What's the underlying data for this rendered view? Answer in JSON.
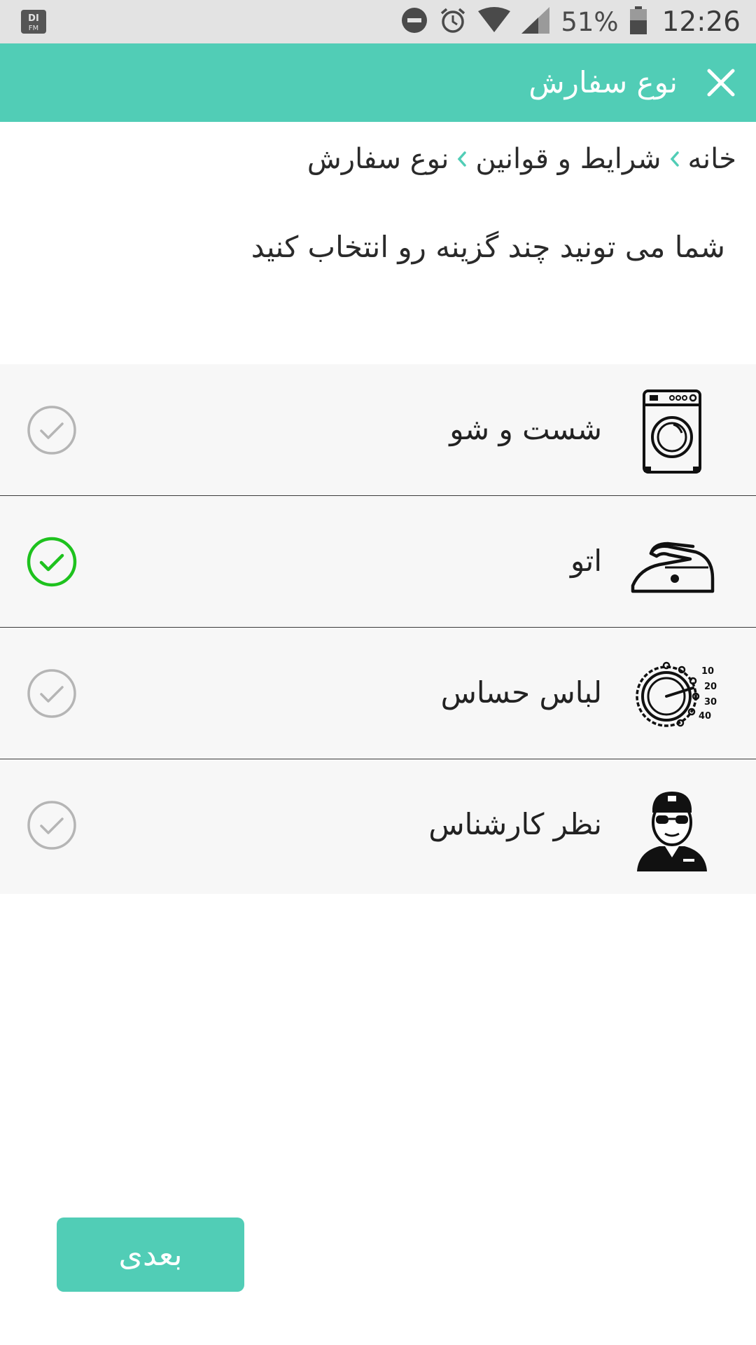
{
  "status_bar": {
    "battery_text": "51%",
    "time": "12:26",
    "icons": [
      "app-logo-icon",
      "dnd-icon",
      "alarm-icon",
      "wifi-icon",
      "signal-icon",
      "battery-icon"
    ]
  },
  "app_bar": {
    "title": "نوع سفارش",
    "close_icon": "close-icon"
  },
  "breadcrumb": {
    "items": [
      "خانه",
      "شرایط و قوانین",
      "نوع سفارش"
    ],
    "separator_icon": "chevron-right-icon",
    "separator_color": "#51cdb6"
  },
  "hint": "شما می تونید چند گزینه رو انتخاب کنید",
  "options": [
    {
      "label": "شست و شو",
      "icon": "washing-machine-icon",
      "selected": false
    },
    {
      "label": "اتو",
      "icon": "iron-icon",
      "selected": true
    },
    {
      "label": "لباس حساس",
      "icon": "temperature-dial-icon",
      "selected": false,
      "dial_labels": [
        "10",
        "20",
        "30",
        "40"
      ]
    },
    {
      "label": "نظر کارشناس",
      "icon": "expert-icon",
      "selected": false
    }
  ],
  "next_button": {
    "label": "بعدی"
  },
  "colors": {
    "accent": "#51cdb6",
    "check_selected": "#1ec21e",
    "check_unselected": "#b5b5b5",
    "row_background": "#f7f7f7"
  }
}
